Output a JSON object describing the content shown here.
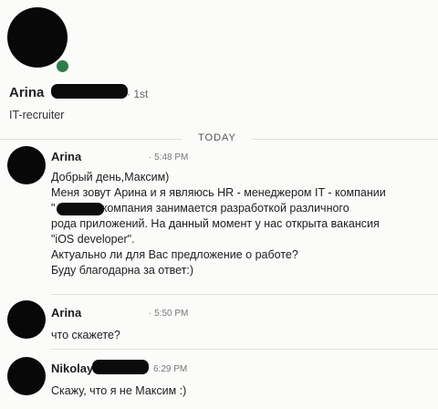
{
  "profile": {
    "name": "Arina",
    "degree": "· 1st",
    "headline": "IT-recruiter"
  },
  "divider": {
    "label": "TODAY"
  },
  "messages": [
    {
      "sender": "Arina",
      "time": "· 5:48 PM",
      "lines": [
        "Добрый день,Максим)",
        "Меня зовут Арина и я являюсь HR - менеджером IT - компании",
        "\"         \". Наша компания занимается разработкой различного",
        "рода приложений. На данный момент у нас открыта вакансия",
        "\"iOS developer\".",
        "Актуально ли для Вас предложение о работе?",
        "Буду благодарна за ответ:)"
      ]
    },
    {
      "sender": "Arina",
      "time": "· 5:50 PM",
      "lines": [
        "что скажете?"
      ]
    },
    {
      "sender": "Nikolay",
      "time": "6:29 PM",
      "lines": [
        "Скажу, что я не Максим :)"
      ]
    }
  ],
  "colors": {
    "background": "#fbfbfa",
    "online_dot": "#2f7d4a",
    "redaction": "#0b0b0b"
  },
  "icons": [
    "profile-avatar",
    "online-status-dot",
    "message-avatar"
  ]
}
